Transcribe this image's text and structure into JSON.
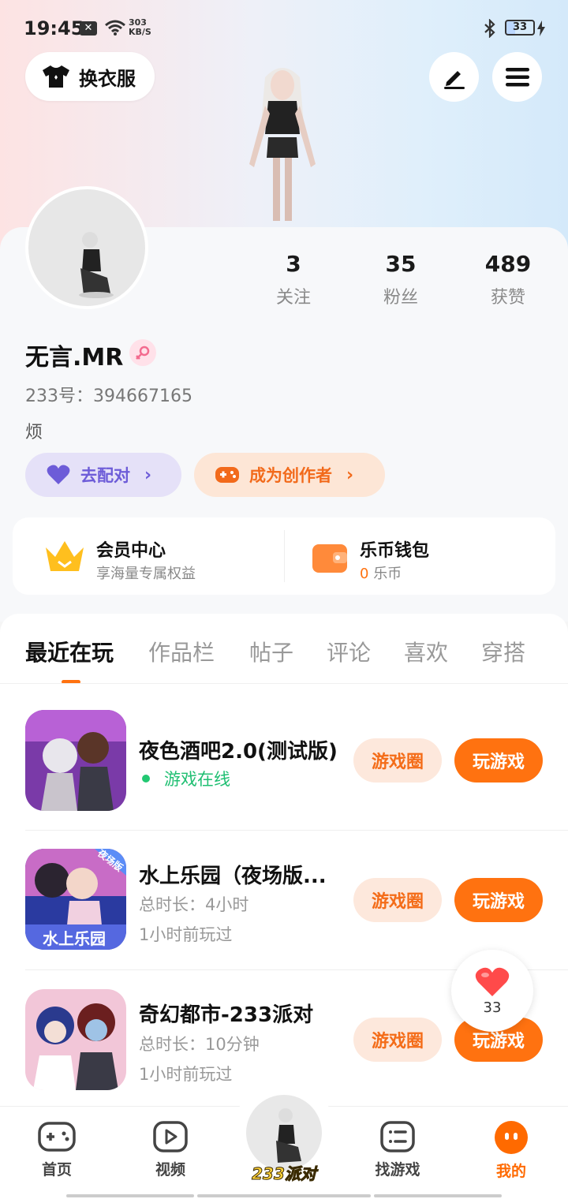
{
  "status_bar": {
    "time": "19:45",
    "speed_value": "303",
    "speed_unit": "KB/S",
    "battery": "33"
  },
  "header": {
    "outfit_button": "换衣服"
  },
  "profile": {
    "username": "无言.MR",
    "id_line": "233号：394667165",
    "bio": "烦",
    "stats": [
      {
        "num": "3",
        "label": "关注"
      },
      {
        "num": "35",
        "label": "粉丝"
      },
      {
        "num": "489",
        "label": "获赞"
      }
    ],
    "pair_button": "去配对",
    "creator_button": "成为创作者"
  },
  "vip": {
    "title": "会员中心",
    "subtitle": "享海量专属权益"
  },
  "wallet": {
    "title": "乐币钱包",
    "amount": "0",
    "unit": "乐币"
  },
  "tabs": [
    "最近在玩",
    "作品栏",
    "帖子",
    "评论",
    "喜欢",
    "穿搭"
  ],
  "games": [
    {
      "title": "夜色酒吧2.0(测试版)",
      "status": "游戏在线"
    },
    {
      "title": "水上乐园（夜场版...",
      "duration": "总时长：4小时",
      "last_played": "1小时前玩过",
      "icon_badge": "夜场版",
      "icon_text": "水上乐园"
    },
    {
      "title": "奇幻都市-233派对",
      "duration": "总时长：10分钟",
      "last_played": "1小时前玩过"
    }
  ],
  "game_buttons": {
    "circle": "游戏圈",
    "play": "玩游戏"
  },
  "like_count": "33",
  "nav": {
    "home": "首页",
    "video": "视频",
    "center": "233派对",
    "find": "找游戏",
    "mine": "我的"
  },
  "colors": {
    "accent": "#ff7210",
    "online": "#1fbf72",
    "pair": "#6d5cd8"
  }
}
